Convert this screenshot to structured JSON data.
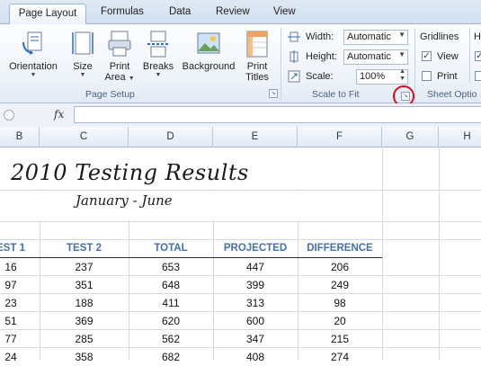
{
  "tabs": {
    "active": "Page Layout",
    "formulas": "Formulas",
    "data": "Data",
    "review": "Review",
    "view": "View"
  },
  "ribbon": {
    "orientation": "Orientation",
    "size": "Size",
    "print_area_1": "Print",
    "print_area_2": "Area",
    "breaks": "Breaks",
    "background": "Background",
    "print_titles_1": "Print",
    "print_titles_2": "Titles",
    "page_setup_label": "Page Setup",
    "width_label": "Width:",
    "width_value": "Automatic",
    "height_label": "Height:",
    "height_value": "Automatic",
    "scale_label": "Scale:",
    "scale_value": "100%",
    "scale_to_fit_label": "Scale to Fit",
    "gridlines_label": "Gridlines",
    "gridlines_view": "View",
    "gridlines_print": "Print",
    "sheet_options_label": "Sheet Optio",
    "headings_partial": "H"
  },
  "formula_bar": {
    "fx": "fx",
    "value": ""
  },
  "columns": [
    "B",
    "C",
    "D",
    "E",
    "F",
    "G",
    "H"
  ],
  "sheet": {
    "title": "2010 Testing Results",
    "subtitle": "January - June",
    "headers": [
      "EST 1",
      "TEST 2",
      "TOTAL",
      "PROJECTED",
      "DIFFERENCE"
    ],
    "rows": [
      [
        "16",
        "237",
        "653",
        "447",
        "206"
      ],
      [
        "97",
        "351",
        "648",
        "399",
        "249"
      ],
      [
        "23",
        "188",
        "411",
        "313",
        "98"
      ],
      [
        "51",
        "369",
        "620",
        "600",
        "20"
      ],
      [
        "77",
        "285",
        "562",
        "347",
        "215"
      ],
      [
        "24",
        "358",
        "682",
        "408",
        "274"
      ]
    ]
  },
  "colors": {
    "header_text": "#4471a8",
    "highlight_circle": "#d0101a"
  }
}
